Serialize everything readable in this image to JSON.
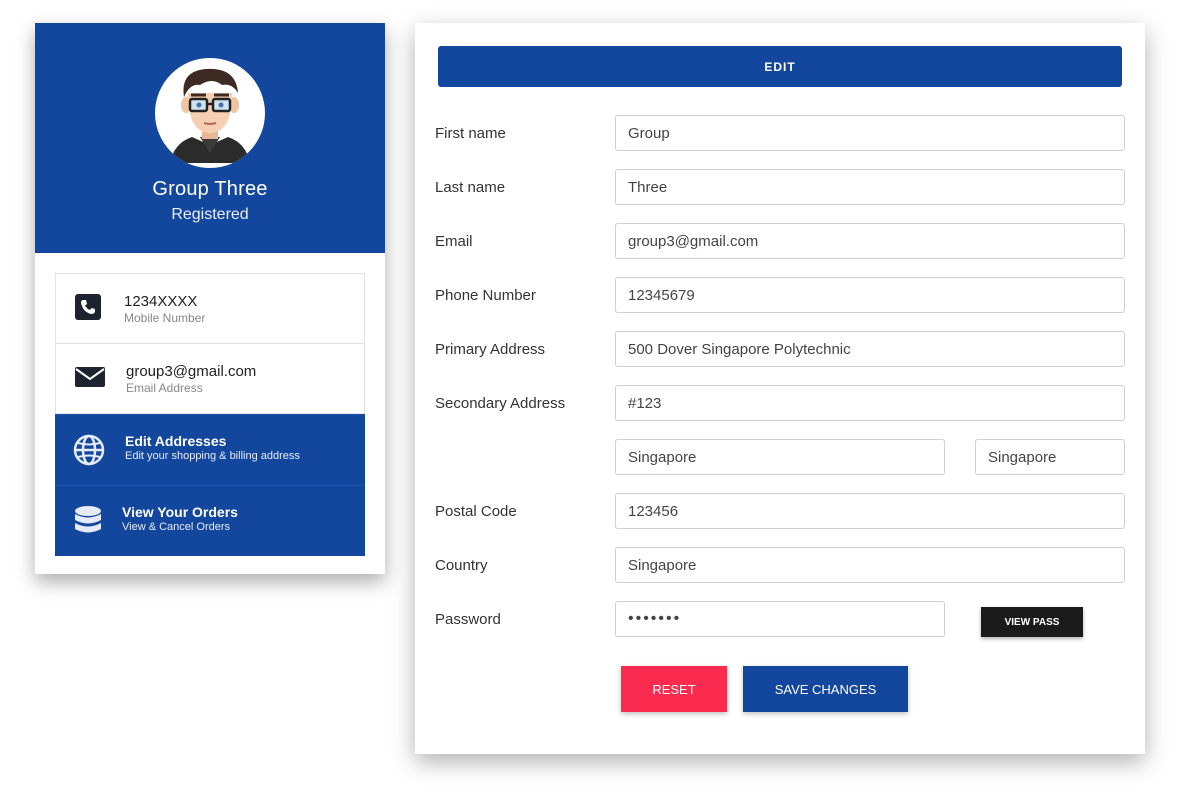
{
  "profile": {
    "name": "Group Three",
    "status": "Registered",
    "phone": {
      "value": "1234XXXX",
      "label": "Mobile Number",
      "icon": "phone-icon"
    },
    "email": {
      "value": "group3@gmail.com",
      "label": "Email Address",
      "icon": "envelope-icon"
    },
    "actions": [
      {
        "title": "Edit Addresses",
        "subtitle": "Edit your shopping & billing address",
        "icon": "globe-icon"
      },
      {
        "title": "View Your Orders",
        "subtitle": "View & Cancel Orders",
        "icon": "database-icon"
      }
    ]
  },
  "form": {
    "header": "EDIT",
    "fields": {
      "first_name": {
        "label": "First name",
        "value": "Group"
      },
      "last_name": {
        "label": "Last name",
        "value": "Three"
      },
      "email": {
        "label": "Email",
        "value": "group3@gmail.com"
      },
      "phone": {
        "label": "Phone Number",
        "value": "12345679"
      },
      "primary_address": {
        "label": "Primary Address",
        "value": "500 Dover Singapore Polytechnic"
      },
      "secondary_address": {
        "label": "Secondary Address",
        "value": "#123"
      },
      "city": {
        "value": "Singapore"
      },
      "state": {
        "value": "Singapore"
      },
      "postal_code": {
        "label": "Postal Code",
        "value": "123456"
      },
      "country": {
        "label": "Country",
        "value": "Singapore"
      },
      "password": {
        "label": "Password",
        "value": "•••••••"
      }
    },
    "view_pass_label": "VIEW PASS",
    "reset_label": "RESET",
    "save_label": "SAVE CHANGES"
  },
  "colors": {
    "primary": "#13479d",
    "reset": "#fb2b50",
    "dark_button": "#1b1b1b"
  }
}
